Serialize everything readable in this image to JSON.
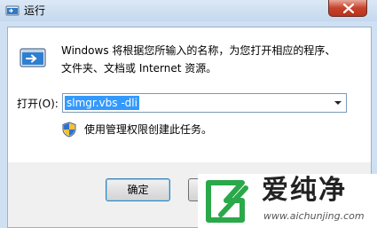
{
  "window": {
    "title": "运行"
  },
  "description": {
    "line1": "Windows 将根据您所输入的名称，为您打开相应的程序、",
    "line2": "文件夹、文档或 Internet 资源。"
  },
  "open_field": {
    "label": "打开(O):",
    "value": "slmgr.vbs -dli"
  },
  "admin_note": "使用管理权限创建此任务。",
  "buttons": {
    "ok_label": "确定"
  },
  "watermark": {
    "name": "爱纯净",
    "url": "www.aichunjing.com"
  },
  "icons": {
    "title": "run-app-icon",
    "main": "run-program-icon",
    "shield": "uac-shield-icon",
    "dropdown": "chevron-down-icon",
    "close": "close-icon"
  },
  "colors": {
    "selection": "#3399ff",
    "close_button": "#c7422a",
    "default_button_border": "#3c7fb1",
    "watermark_green": "#2aa84a"
  }
}
